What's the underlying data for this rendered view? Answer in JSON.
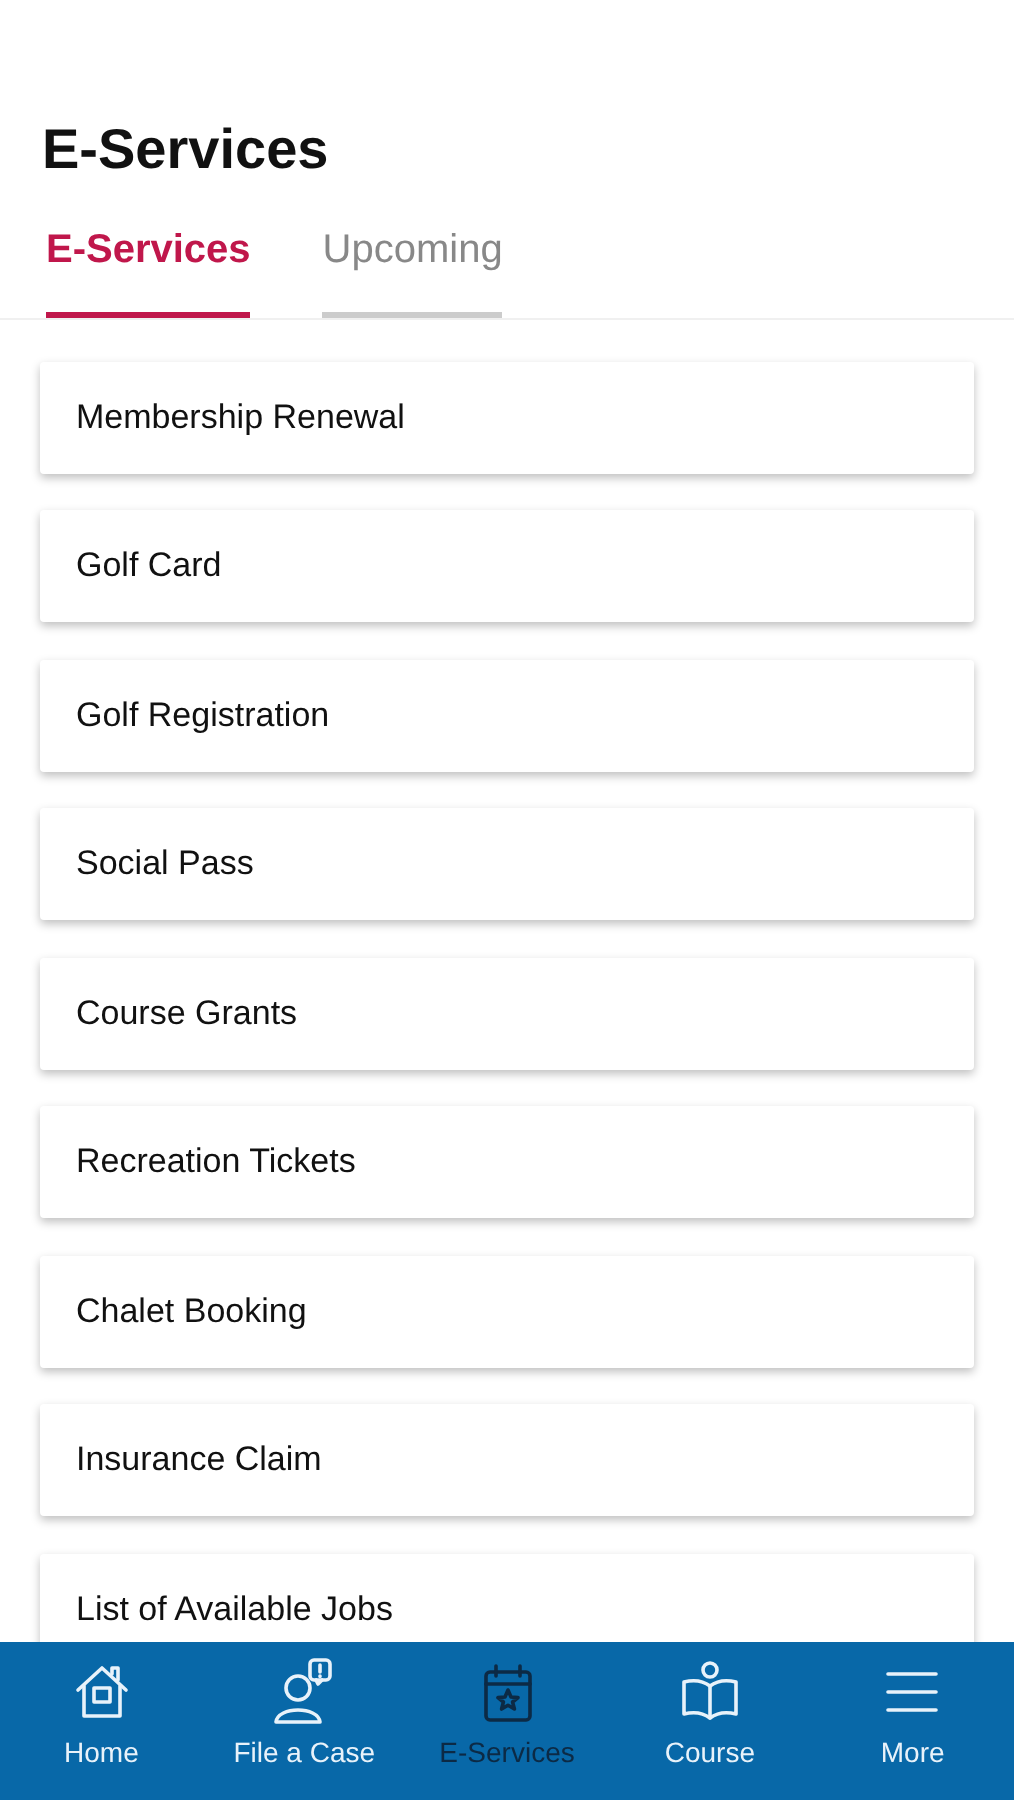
{
  "header": {
    "title": "E-Services"
  },
  "tabs": [
    {
      "label": "E-Services",
      "selected": true
    },
    {
      "label": "Upcoming",
      "selected": false
    }
  ],
  "services": [
    {
      "label": "Membership Renewal"
    },
    {
      "label": "Golf Card"
    },
    {
      "label": "Golf Registration"
    },
    {
      "label": "Social Pass"
    },
    {
      "label": "Course Grants"
    },
    {
      "label": "Recreation Tickets"
    },
    {
      "label": "Chalet Booking"
    },
    {
      "label": "Insurance Claim"
    },
    {
      "label": "List of Available Jobs"
    }
  ],
  "bottom_nav": [
    {
      "label": "Home",
      "kind": "home",
      "selected": false
    },
    {
      "label": "File a Case",
      "kind": "case",
      "selected": false
    },
    {
      "label": "E-Services",
      "kind": "services",
      "selected": true
    },
    {
      "label": "Course",
      "kind": "course",
      "selected": false
    },
    {
      "label": "More",
      "kind": "more",
      "selected": false
    }
  ]
}
